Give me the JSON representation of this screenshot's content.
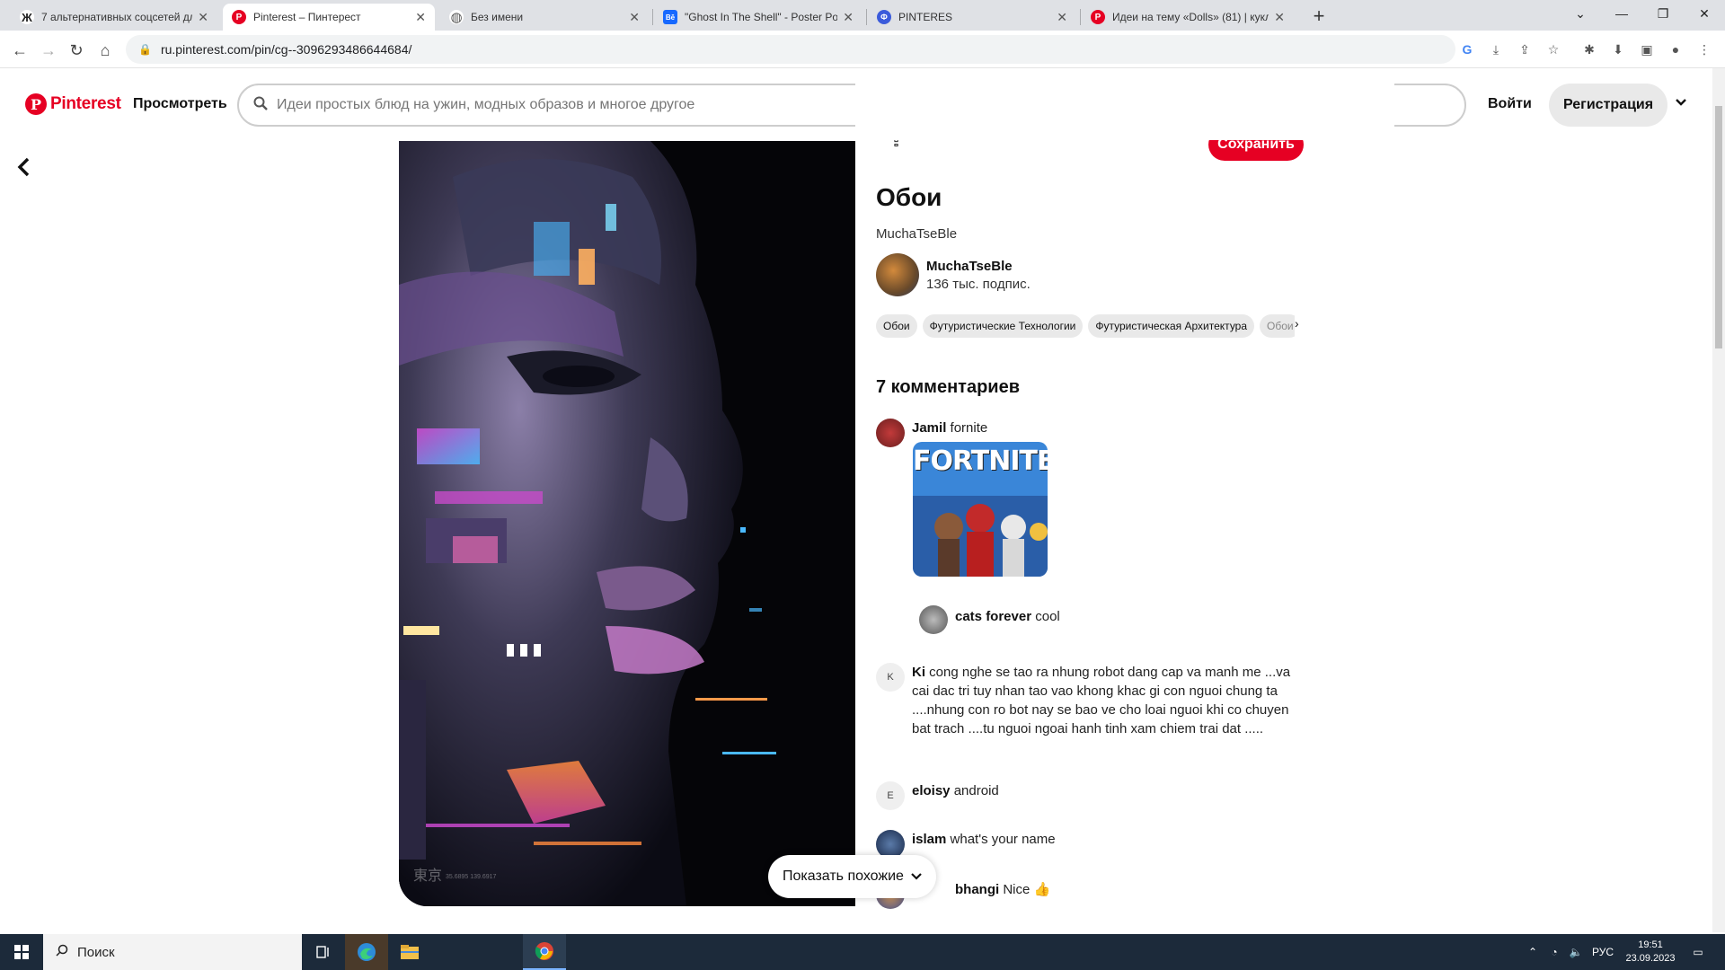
{
  "browser": {
    "tabs": [
      {
        "title": "7 альтернативных соцсетей для",
        "favicon": "zen-icon",
        "favicon_glyph": "Ж",
        "favicon_color": "#222222",
        "active": false
      },
      {
        "title": "Pinterest – Пинтерест",
        "favicon": "pinterest-icon",
        "favicon_glyph": "P",
        "favicon_color": "#e60023",
        "active": true
      },
      {
        "title": "Без имени",
        "favicon": "globe-icon",
        "favicon_glyph": "◍",
        "favicon_color": "#666666",
        "active": false
      },
      {
        "title": "\"Ghost In The Shell\" - Poster Pos",
        "favicon": "behance-icon",
        "favicon_glyph": "Bē",
        "favicon_color": "#1769ff",
        "active": false
      },
      {
        "title": "PINTERES",
        "favicon": "generic-icon",
        "favicon_glyph": "Ф",
        "favicon_color": "#3b5bdb",
        "active": false
      },
      {
        "title": "Идеи на тему «Dolls» (81) | кукл",
        "favicon": "pinterest-icon",
        "favicon_glyph": "P",
        "favicon_color": "#e60023",
        "active": false
      }
    ],
    "url": "ru.pinterest.com/pin/cg--3096293486644684/"
  },
  "header": {
    "logo_text": "Pinterest",
    "browse": "Просмотреть",
    "search_placeholder": "Идеи простых блюд на ужин, модных образов и многое другое",
    "login": "Войти",
    "signup": "Регистрация"
  },
  "pin": {
    "save": "Сохранить",
    "title": "Обои",
    "subtitle": "MuchaTseBle",
    "author_name": "MuchaTseBle",
    "author_followers": "136 тыс. подпис.",
    "image_caption_jp": "東京",
    "image_caption_coords": "35.6895 139.6917",
    "tags": [
      "Обои",
      "Футуристические Технологии",
      "Футуристическая Архитектура",
      "Обои"
    ]
  },
  "comments": {
    "heading": "7 комментариев",
    "items": [
      {
        "user": "Jamil",
        "text": "fornite",
        "avatar_letter": ""
      },
      {
        "user": "cats forever",
        "text": "cool",
        "avatar_letter": ""
      },
      {
        "user": "Ki",
        "text": "cong nghe se tao ra nhung robot dang cap va manh me ...va cai dac tri tuy nhan tao vao khong khac gi con nguoi chung ta ....nhung con ro bot nay se bao ve cho loai nguoi khi co chuyen bat trach ....tu nguoi ngoai hanh tinh xam chiem trai dat .....",
        "avatar_letter": "K"
      },
      {
        "user": "eloisy",
        "text": "android",
        "avatar_letter": "E"
      },
      {
        "user": "islam",
        "text": "what's your name",
        "avatar_letter": ""
      },
      {
        "user": "bhangi",
        "text": "Nice 👍",
        "avatar_letter": ""
      }
    ],
    "fortnite_label": "FORTNITE"
  },
  "show_similar": "Показать похожие",
  "taskbar": {
    "search": "Поиск",
    "lang": "РУС",
    "time": "19:51",
    "date": "23.09.2023"
  },
  "colors": {
    "brand": "#e60023",
    "taskbar": "#1c2a3a"
  }
}
